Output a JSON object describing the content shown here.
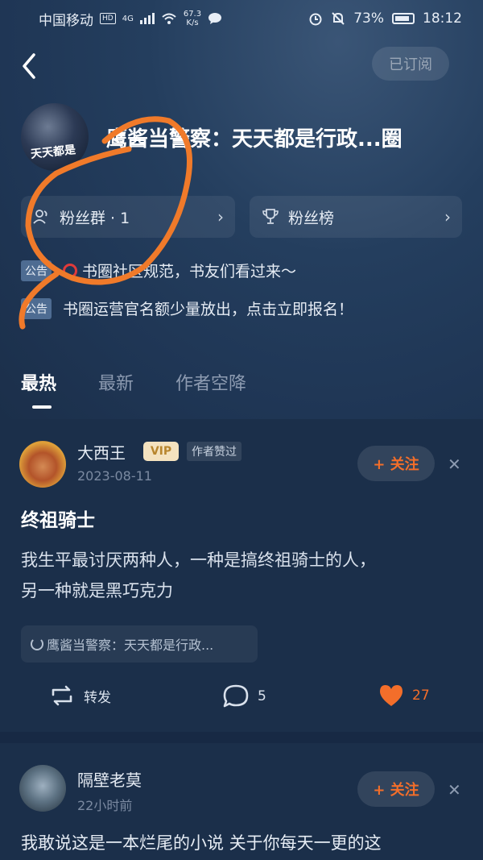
{
  "status_bar": {
    "carrier": "中国移动",
    "hd": "HD",
    "signal_type": "4G",
    "speed_value": "67.3",
    "speed_unit": "K/s",
    "battery": "73%",
    "time": "18:12"
  },
  "header": {
    "subscribe_label": "已订阅",
    "cover_text": "天天都是",
    "title": "鹰酱当警察：天天都是行政...圈"
  },
  "fans": {
    "group_label": "粉丝群 · 1",
    "rank_label": "粉丝榜"
  },
  "notices": [
    {
      "tag": "公告",
      "text": "书圈社区规范，书友们看过来～"
    },
    {
      "tag": "公告",
      "text": "书圈运营官名额少量放出，点击立即报名！"
    }
  ],
  "tabs": [
    {
      "label": "最热",
      "active": true
    },
    {
      "label": "最新",
      "active": false
    },
    {
      "label": "作者空降",
      "active": false
    }
  ],
  "posts": [
    {
      "author": "大西王",
      "vip": "VIP",
      "author_tag": "作者赞过",
      "date": "2023-08-11",
      "follow_label": "+ 关注",
      "title": "终祖骑士",
      "body_line1": "我生平最讨厌两种人，一种是搞终祖骑士的人，",
      "body_line2": "另一种就是黑巧克力",
      "book_ref": "鹰酱当警察：天天都是行政...",
      "repost_label": "转发",
      "comments": "5",
      "likes": "27"
    },
    {
      "author": "隔壁老莫",
      "date": "22小时前",
      "follow_label": "+ 关注",
      "body_preview": "我敢说这是一本烂尾的小说 关于你每天一更的这"
    }
  ],
  "colors": {
    "accent": "#f36e2a",
    "background": "#1b2f4a",
    "annotation": "#f07a2a"
  }
}
